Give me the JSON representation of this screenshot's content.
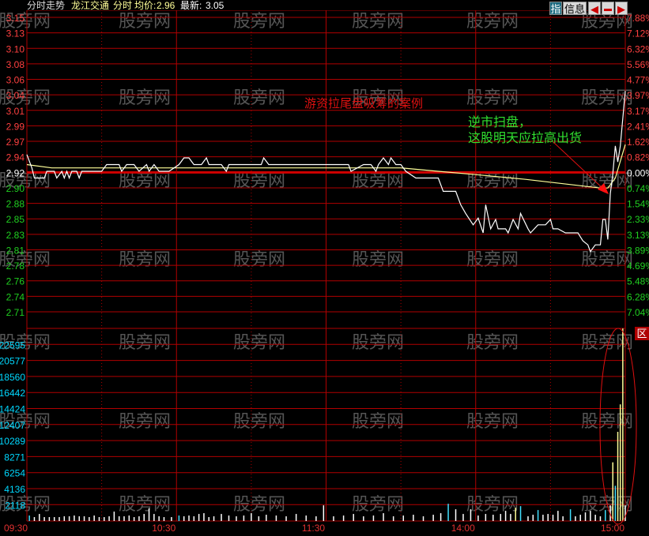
{
  "header": {
    "view_label": "分时走势",
    "stock_name": "龙江交通",
    "mode": "分时",
    "avg_label": "均价:",
    "avg_value": "2.96",
    "latest_label": "最新:",
    "latest_value": "3.05",
    "btn_index": "指",
    "btn_info": "信息",
    "btn_area": "区"
  },
  "watermark": "股旁网",
  "annotations": {
    "title": "游资拉尾盘吸筹的案例",
    "note_line1": "逆市扫盘，",
    "note_line2": "这股明天应拉高出货"
  },
  "colors": {
    "grid": "#b00000",
    "up": "#ff4040",
    "down": "#20d020",
    "price": "#ffffff",
    "avg": "#ffff99",
    "vol_axis": "#00d8ff",
    "note": "#30e030",
    "title": "#e01010"
  },
  "chart_data": {
    "type": "line",
    "title": "龙江交通 分时",
    "prev_close": 2.92,
    "price_ticks": [
      "3.15",
      "3.13",
      "3.10",
      "3.08",
      "3.06",
      "3.04",
      "3.01",
      "2.99",
      "2.97",
      "2.94",
      "2.92",
      "2.90",
      "2.88",
      "2.85",
      "2.83",
      "2.81",
      "2.78",
      "2.76",
      "2.74",
      "2.71"
    ],
    "pct_ticks": [
      "7.88%",
      "7.12%",
      "6.32%",
      "5.56%",
      "4.77%",
      "3.97%",
      "3.17%",
      "2.41%",
      "1.62%",
      "0.82%",
      "0.00%",
      "0.74%",
      "1.54%",
      "2.33%",
      "3.13%",
      "3.89%",
      "4.69%",
      "5.48%",
      "6.28%",
      "7.04%"
    ],
    "ylim": [
      2.71,
      3.15
    ],
    "xlim_minutes": [
      0,
      240
    ],
    "time_ticks": [
      {
        "label": "09:30",
        "minute": 0
      },
      {
        "label": "10:30",
        "minute": 60
      },
      {
        "label": "11:30",
        "minute": 120
      },
      {
        "label": "14:00",
        "minute": 180
      },
      {
        "label": "15:00",
        "minute": 240
      }
    ],
    "price_series": [
      [
        0,
        2.945
      ],
      [
        2,
        2.925
      ],
      [
        3,
        2.91
      ],
      [
        7,
        2.91
      ],
      [
        8,
        2.92
      ],
      [
        11,
        2.92
      ],
      [
        12,
        2.91
      ],
      [
        14,
        2.92
      ],
      [
        15,
        2.91
      ],
      [
        16,
        2.92
      ],
      [
        17,
        2.91
      ],
      [
        18,
        2.92
      ],
      [
        20,
        2.92
      ],
      [
        21,
        2.91
      ],
      [
        22,
        2.92
      ],
      [
        30,
        2.92
      ],
      [
        32,
        2.93
      ],
      [
        37,
        2.93
      ],
      [
        38,
        2.92
      ],
      [
        40,
        2.93
      ],
      [
        43,
        2.93
      ],
      [
        45,
        2.92
      ],
      [
        48,
        2.93
      ],
      [
        49,
        2.92
      ],
      [
        51,
        2.93
      ],
      [
        53,
        2.92
      ],
      [
        57,
        2.92
      ],
      [
        61,
        2.93
      ],
      [
        63,
        2.94
      ],
      [
        65,
        2.94
      ],
      [
        67,
        2.93
      ],
      [
        70,
        2.93
      ],
      [
        72,
        2.94
      ],
      [
        73,
        2.93
      ],
      [
        78,
        2.93
      ],
      [
        80,
        2.92
      ],
      [
        81,
        2.93
      ],
      [
        94,
        2.93
      ],
      [
        95,
        2.94
      ],
      [
        97,
        2.93
      ],
      [
        122,
        2.93
      ],
      [
        129,
        2.93
      ],
      [
        130,
        2.92
      ],
      [
        135,
        2.93
      ],
      [
        138,
        2.93
      ],
      [
        140,
        2.92
      ],
      [
        141,
        2.93
      ],
      [
        143,
        2.94
      ],
      [
        145,
        2.93
      ],
      [
        146,
        2.94
      ],
      [
        148,
        2.93
      ],
      [
        150,
        2.93
      ],
      [
        152,
        2.92
      ],
      [
        156,
        2.91
      ],
      [
        165,
        2.91
      ],
      [
        167,
        2.89
      ],
      [
        172,
        2.89
      ],
      [
        174,
        2.87
      ],
      [
        176,
        2.857
      ],
      [
        179,
        2.84
      ],
      [
        181,
        2.85
      ],
      [
        183,
        2.828
      ],
      [
        184,
        2.87
      ],
      [
        186,
        2.834
      ],
      [
        188,
        2.848
      ],
      [
        189,
        2.834
      ],
      [
        192,
        2.834
      ],
      [
        193,
        2.828
      ],
      [
        195,
        2.848
      ],
      [
        197,
        2.834
      ],
      [
        198,
        2.857
      ],
      [
        201,
        2.834
      ],
      [
        202,
        2.828
      ],
      [
        205,
        2.84
      ],
      [
        208,
        2.84
      ],
      [
        210,
        2.848
      ],
      [
        211,
        2.834
      ],
      [
        213,
        2.834
      ],
      [
        216,
        2.828
      ],
      [
        221,
        2.828
      ],
      [
        222,
        2.822
      ],
      [
        223,
        2.816
      ],
      [
        225,
        2.81
      ],
      [
        226,
        2.8
      ],
      [
        228,
        2.81
      ],
      [
        230,
        2.81
      ],
      [
        231,
        2.848
      ],
      [
        232,
        2.848
      ],
      [
        233,
        2.818
      ],
      [
        234,
        2.887
      ],
      [
        235,
        2.916
      ],
      [
        236,
        2.958
      ],
      [
        237,
        2.934
      ],
      [
        238,
        2.958
      ],
      [
        240,
        3.04
      ]
    ],
    "avg_series": [
      [
        0,
        2.93
      ],
      [
        10,
        2.925
      ],
      [
        60,
        2.925
      ],
      [
        150,
        2.925
      ],
      [
        165,
        2.92
      ],
      [
        180,
        2.915
      ],
      [
        200,
        2.908
      ],
      [
        230,
        2.895
      ],
      [
        233,
        2.895
      ],
      [
        236,
        2.91
      ],
      [
        240,
        2.96
      ]
    ],
    "vol_ticks": [
      "22595",
      "20577",
      "18560",
      "16442",
      "14424",
      "12407",
      "10289",
      "8271",
      "6254",
      "4136",
      "2118"
    ],
    "vol_ylim": [
      0,
      24613
    ],
    "volume": [
      [
        1,
        700,
        "c"
      ],
      [
        3,
        500,
        "w"
      ],
      [
        5,
        900,
        "w"
      ],
      [
        7,
        500,
        "w"
      ],
      [
        9,
        500,
        "w"
      ],
      [
        11,
        500,
        "w"
      ],
      [
        13,
        500,
        "w"
      ],
      [
        15,
        600,
        "w"
      ],
      [
        17,
        600,
        "w"
      ],
      [
        19,
        700,
        "w"
      ],
      [
        21,
        600,
        "w"
      ],
      [
        23,
        600,
        "w"
      ],
      [
        25,
        500,
        "w"
      ],
      [
        27,
        700,
        "w"
      ],
      [
        29,
        500,
        "w"
      ],
      [
        31,
        500,
        "w"
      ],
      [
        33,
        600,
        "w"
      ],
      [
        35,
        1200,
        "w"
      ],
      [
        37,
        600,
        "w"
      ],
      [
        39,
        600,
        "w"
      ],
      [
        41,
        700,
        "w"
      ],
      [
        43,
        500,
        "w"
      ],
      [
        45,
        600,
        "w"
      ],
      [
        47,
        900,
        "w"
      ],
      [
        49,
        1600,
        "w"
      ],
      [
        51,
        900,
        "w"
      ],
      [
        53,
        600,
        "w"
      ],
      [
        55,
        500,
        "w"
      ],
      [
        58,
        500,
        "w"
      ],
      [
        61,
        700,
        "c"
      ],
      [
        63,
        600,
        "w"
      ],
      [
        65,
        700,
        "w"
      ],
      [
        67,
        600,
        "w"
      ],
      [
        69,
        900,
        "w"
      ],
      [
        71,
        1000,
        "w"
      ],
      [
        73,
        500,
        "w"
      ],
      [
        75,
        600,
        "w"
      ],
      [
        78,
        900,
        "w"
      ],
      [
        81,
        700,
        "w"
      ],
      [
        84,
        600,
        "w"
      ],
      [
        87,
        700,
        "w"
      ],
      [
        90,
        1000,
        "w"
      ],
      [
        93,
        600,
        "w"
      ],
      [
        96,
        800,
        "w"
      ],
      [
        100,
        700,
        "w"
      ],
      [
        104,
        600,
        "w"
      ],
      [
        108,
        900,
        "w"
      ],
      [
        112,
        700,
        "w"
      ],
      [
        116,
        600,
        "w"
      ],
      [
        119,
        2000,
        "w"
      ],
      [
        123,
        600,
        "w"
      ],
      [
        127,
        700,
        "w"
      ],
      [
        131,
        900,
        "w"
      ],
      [
        135,
        600,
        "w"
      ],
      [
        139,
        700,
        "w"
      ],
      [
        143,
        1000,
        "w"
      ],
      [
        147,
        600,
        "w"
      ],
      [
        151,
        700,
        "w"
      ],
      [
        155,
        800,
        "w"
      ],
      [
        159,
        600,
        "w"
      ],
      [
        163,
        800,
        "w"
      ],
      [
        166,
        1000,
        "w"
      ],
      [
        169,
        2200,
        "c"
      ],
      [
        172,
        1500,
        "w"
      ],
      [
        175,
        900,
        "w"
      ],
      [
        178,
        1500,
        "w"
      ],
      [
        181,
        700,
        "w"
      ],
      [
        184,
        900,
        "w"
      ],
      [
        187,
        800,
        "w"
      ],
      [
        190,
        900,
        "w"
      ],
      [
        192,
        1300,
        "w"
      ],
      [
        194,
        900,
        "w"
      ],
      [
        196,
        1700,
        "y"
      ],
      [
        198,
        1900,
        "c"
      ],
      [
        201,
        600,
        "w"
      ],
      [
        203,
        800,
        "w"
      ],
      [
        205,
        1400,
        "c"
      ],
      [
        207,
        800,
        "w"
      ],
      [
        209,
        900,
        "w"
      ],
      [
        211,
        800,
        "w"
      ],
      [
        213,
        1300,
        "w"
      ],
      [
        215,
        600,
        "w"
      ],
      [
        218,
        1500,
        "c"
      ],
      [
        220,
        600,
        "w"
      ],
      [
        222,
        800,
        "w"
      ],
      [
        224,
        1100,
        "w"
      ],
      [
        226,
        1300,
        "w"
      ],
      [
        228,
        800,
        "w"
      ],
      [
        230,
        600,
        "w"
      ],
      [
        232,
        1400,
        "c"
      ],
      [
        234,
        2000,
        "w"
      ],
      [
        235,
        7500,
        "y"
      ],
      [
        236,
        4500,
        "c"
      ],
      [
        237,
        11400,
        "y"
      ],
      [
        238,
        14900,
        "y"
      ],
      [
        239,
        24600,
        "y"
      ],
      [
        240,
        2000,
        "w"
      ]
    ]
  }
}
